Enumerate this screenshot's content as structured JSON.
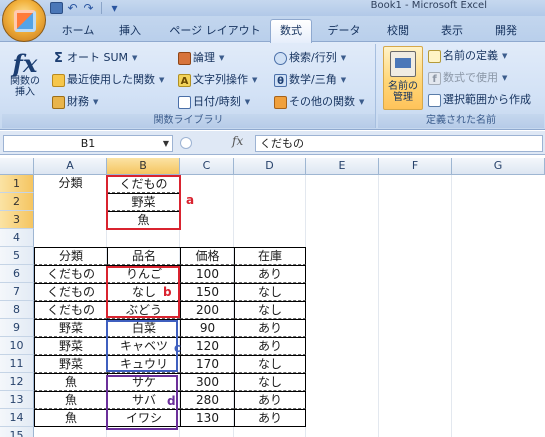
{
  "window": {
    "title": "Book1 - Microsoft Excel"
  },
  "ribbon": {
    "tabs": [
      {
        "label": "ホーム"
      },
      {
        "label": "挿入"
      },
      {
        "label": "ページ レイアウト"
      },
      {
        "label": "数式",
        "active": true
      },
      {
        "label": "データ"
      },
      {
        "label": "校閲"
      },
      {
        "label": "表示"
      },
      {
        "label": "開発"
      }
    ],
    "function_library": {
      "group_label": "関数ライブラリ",
      "insert_function_label_1": "関数の",
      "insert_function_label_2": "挿入",
      "autosum": "オート SUM",
      "recently_used": "最近使用した関数",
      "financial": "財務",
      "logical": "論理",
      "text": "文字列操作",
      "datetime": "日付/時刻",
      "lookup": "検索/行列",
      "math": "数学/三角",
      "more": "その他の関数"
    },
    "defined_names": {
      "group_label": "定義された名前",
      "manager_label_1": "名前の",
      "manager_label_2": "管理",
      "define_name": "名前の定義",
      "use_in_formula": "数式で使用",
      "create_from_selection": "選択範囲から作成"
    }
  },
  "formula_bar": {
    "name_box": "B1",
    "fx": "fx",
    "content": "くだもの"
  },
  "sheet": {
    "columns": [
      "A",
      "B",
      "C",
      "D",
      "E",
      "F",
      "G"
    ],
    "rows": [
      "1",
      "2",
      "3",
      "4",
      "5",
      "6",
      "7",
      "8",
      "9",
      "10",
      "11",
      "12",
      "13",
      "14",
      "15"
    ],
    "category_header": "分類",
    "categories": [
      "くだもの",
      "野菜",
      "魚"
    ],
    "table_headers": [
      "分類",
      "品名",
      "価格",
      "在庫"
    ],
    "table_rows": [
      [
        "くだもの",
        "りんご",
        "100",
        "あり"
      ],
      [
        "くだもの",
        "なし",
        "150",
        "なし"
      ],
      [
        "くだもの",
        "ぶどう",
        "200",
        "なし"
      ],
      [
        "野菜",
        "白菜",
        "90",
        "あり"
      ],
      [
        "野菜",
        "キャベツ",
        "120",
        "あり"
      ],
      [
        "野菜",
        "キュウリ",
        "170",
        "なし"
      ],
      [
        "魚",
        "サケ",
        "300",
        "なし"
      ],
      [
        "魚",
        "サバ",
        "280",
        "あり"
      ],
      [
        "魚",
        "イワシ",
        "130",
        "あり"
      ]
    ]
  },
  "annotations": {
    "a": "a",
    "b": "b",
    "c": "c",
    "d": "d",
    "colors": {
      "a": "#d9232f",
      "b": "#d9232f",
      "c": "#3f5fbf",
      "d": "#6b2f9a"
    }
  },
  "colors": {
    "ribbon_bg": "#d3e2f6",
    "header_selected": "#f5c561",
    "grid_header": "#dde6f2"
  }
}
